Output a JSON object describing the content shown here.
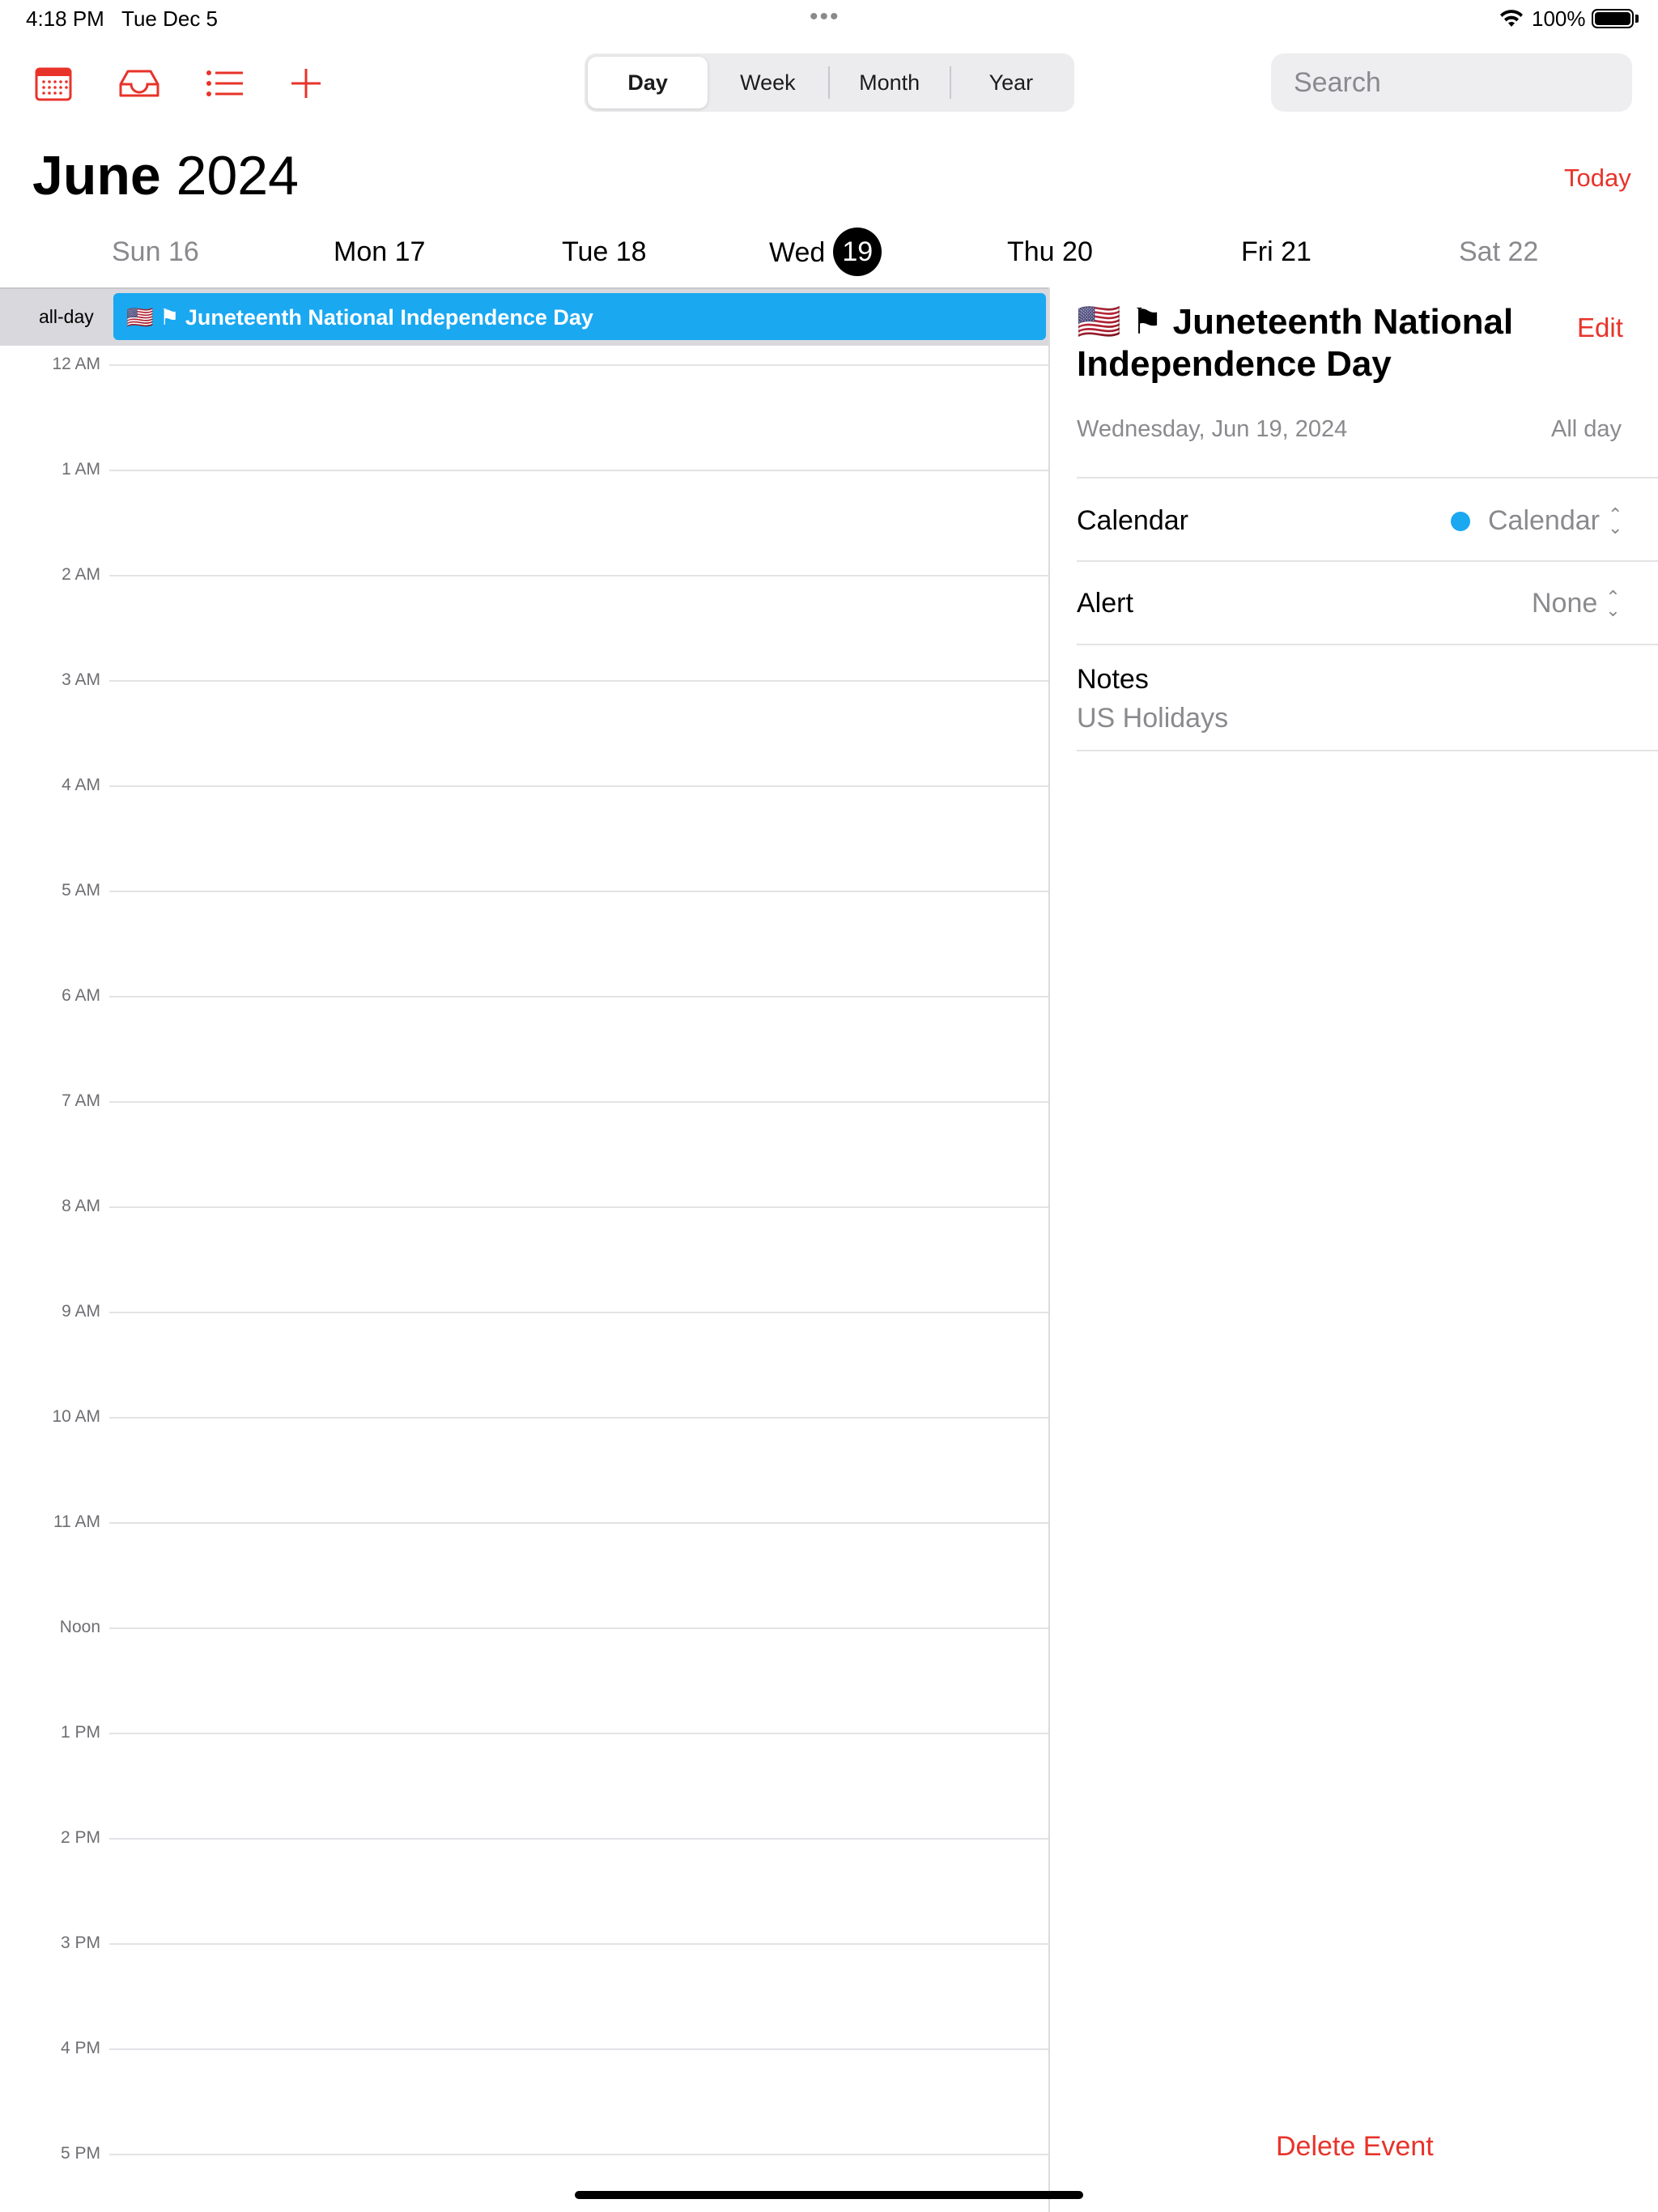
{
  "status": {
    "time": "4:18 PM",
    "date": "Tue Dec 5",
    "more": "•••",
    "battery_pct": "100%",
    "battery_level": 1.0
  },
  "toolbar": {
    "icons": [
      "calendar-icon",
      "inbox-icon",
      "list-icon",
      "plus-icon"
    ],
    "accent": "#e8332a",
    "views": [
      "Day",
      "Week",
      "Month",
      "Year"
    ],
    "active_view": "Day",
    "search_placeholder": "Search"
  },
  "header": {
    "month": "June",
    "year": "2024",
    "today": "Today"
  },
  "days": [
    {
      "label": "Sun 16",
      "dim": true
    },
    {
      "label": "Mon 17",
      "dim": false
    },
    {
      "label": "Tue 18",
      "dim": false
    },
    {
      "label": "Wed",
      "badge": "19",
      "dim": false
    },
    {
      "label": "Thu 20",
      "dim": false
    },
    {
      "label": "Fri 21",
      "dim": false
    },
    {
      "label": "Sat 22",
      "dim": true
    }
  ],
  "allday": {
    "label": "all-day",
    "event": "🇺🇸 ⚑ Juneteenth National Independence Day",
    "color": "#1aa8f1"
  },
  "hours": [
    "12 AM",
    "1 AM",
    "2 AM",
    "3 AM",
    "4 AM",
    "5 AM",
    "6 AM",
    "7 AM",
    "8 AM",
    "9 AM",
    "10 AM",
    "11 AM",
    "Noon",
    "1 PM",
    "2 PM",
    "3 PM",
    "4 PM",
    "5 PM"
  ],
  "detail": {
    "title": "🇺🇸 ⚑ Juneteenth National Independence Day",
    "edit": "Edit",
    "date": "Wednesday, Jun 19, 2024",
    "all_day": "All day",
    "calendar_label": "Calendar",
    "calendar_value": "Calendar",
    "alert_label": "Alert",
    "alert_value": "None",
    "notes_label": "Notes",
    "notes_value": "US Holidays",
    "delete": "Delete Event"
  }
}
